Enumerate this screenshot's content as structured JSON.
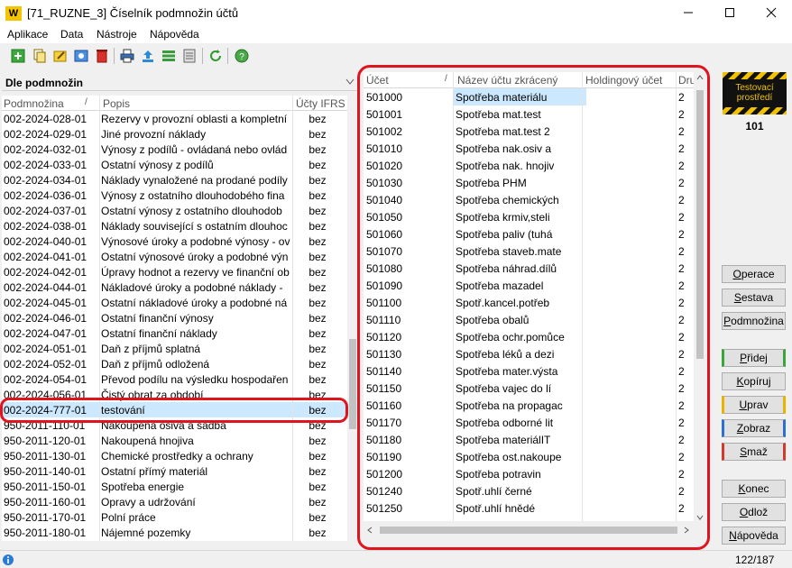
{
  "window": {
    "title": "[71_RUZNE_3] Číselník podmnožin účtů",
    "icon_label": "W",
    "controls": [
      "minimize-icon",
      "maximize-icon",
      "close-icon"
    ]
  },
  "menu": [
    "Aplikace",
    "Data",
    "Nástroje",
    "Nápověda"
  ],
  "toolbar_icons": [
    "add-icon",
    "copy-icon",
    "edit-icon",
    "view-icon",
    "delete-icon",
    "print-icon",
    "export-icon",
    "list-icon",
    "layout-icon",
    "refresh-icon",
    "help-icon"
  ],
  "left_panel": {
    "heading": "Dle podmnožin",
    "columns": [
      "Podmnožina",
      "Popis",
      "Účty IFRS"
    ],
    "rows": [
      [
        "002-2024-028-01",
        "Rezervy v provozní oblasti a kompletní",
        "bez"
      ],
      [
        "002-2024-029-01",
        "Jiné provozní náklady",
        "bez"
      ],
      [
        "002-2024-032-01",
        "Výnosy z podílů - ovládaná nebo ovlád",
        "bez"
      ],
      [
        "002-2024-033-01",
        "Ostatní výnosy  z podílů",
        "bez"
      ],
      [
        "002-2024-034-01",
        "Náklady vynaložené na prodané podíly",
        "bez"
      ],
      [
        "002-2024-036-01",
        "Výnosy z ostatního dlouhodobého fina",
        "bez"
      ],
      [
        "002-2024-037-01",
        "Ostatní výnosy z ostatního dlouhodob",
        "bez"
      ],
      [
        "002-2024-038-01",
        "Náklady související s ostatním dlouhoc",
        "bez"
      ],
      [
        "002-2024-040-01",
        "Výnosové úroky a podobné výnosy - ov",
        "bez"
      ],
      [
        "002-2024-041-01",
        "Ostatní výnosové úroky a podobné výn",
        "bez"
      ],
      [
        "002-2024-042-01",
        "Úpravy hodnot a rezervy ve finanční ob",
        "bez"
      ],
      [
        "002-2024-044-01",
        "Nákladové úroky a podobné náklady -",
        "bez"
      ],
      [
        "002-2024-045-01",
        "Ostatní nákladové úroky a podobné ná",
        "bez"
      ],
      [
        "002-2024-046-01",
        "Ostatní finanční výnosy",
        "bez"
      ],
      [
        "002-2024-047-01",
        "Ostatní finanční náklady",
        "bez"
      ],
      [
        "002-2024-051-01",
        "Daň z příjmů splatná",
        "bez"
      ],
      [
        "002-2024-052-01",
        "Daň z příjmů odložená",
        "bez"
      ],
      [
        "002-2024-054-01",
        "Převod podílu na výsledku hospodařen",
        "bez"
      ],
      [
        "002-2024-056-01",
        "Čistý obrat za období",
        "bez"
      ],
      [
        "002-2024-777-01",
        "testování",
        "bez"
      ],
      [
        "950-2011-110-01",
        "Nakoupená osiva a sadba",
        "bez"
      ],
      [
        "950-2011-120-01",
        "Nakoupená hnojiva",
        "bez"
      ],
      [
        "950-2011-130-01",
        "Chemické prostředky a ochrany",
        "bez"
      ],
      [
        "950-2011-140-01",
        "Ostatní přímý materiál",
        "bez"
      ],
      [
        "950-2011-150-01",
        "Spotřeba energie",
        "bez"
      ],
      [
        "950-2011-160-01",
        "Opravy a udržování",
        "bez"
      ],
      [
        "950-2011-170-01",
        "Polní práce",
        "bez"
      ],
      [
        "950-2011-180-01",
        "Nájemné pozemky",
        "bez"
      ]
    ],
    "selected_index": 19
  },
  "right_panel": {
    "columns": [
      "Účet",
      "Název účtu zkrácený",
      "Holdingový účet",
      "Dru"
    ],
    "rows": [
      [
        "501000",
        "Spotřeba materiálu",
        "",
        "2"
      ],
      [
        "501001",
        "Spotřeba mat.test",
        "",
        "2"
      ],
      [
        "501002",
        "Spotřeba mat.test 2",
        "",
        "2"
      ],
      [
        "501010",
        "Spotřeba nak.osiv a",
        "",
        "2"
      ],
      [
        "501020",
        "Spotřeba nak. hnojiv",
        "",
        "2"
      ],
      [
        "501030",
        "Spotřeba PHM",
        "",
        "2"
      ],
      [
        "501040",
        "Spotřeba chemických",
        "",
        "2"
      ],
      [
        "501050",
        "Spotřeba krmiv,steli",
        "",
        "2"
      ],
      [
        "501060",
        "Spotřeba paliv (tuhá",
        "",
        "2"
      ],
      [
        "501070",
        "Spotřeba staveb.mate",
        "",
        "2"
      ],
      [
        "501080",
        "Spotřeba náhrad.dílů",
        "",
        "2"
      ],
      [
        "501090",
        "Spotřeba mazadel",
        "",
        "2"
      ],
      [
        "501100",
        "Spotř.kancel.potřeb",
        "",
        "2"
      ],
      [
        "501110",
        "Spotřeba obalů",
        "",
        "2"
      ],
      [
        "501120",
        "Spotřeba ochr.pomůce",
        "",
        "2"
      ],
      [
        "501130",
        "Spotřeba léků a dezi",
        "",
        "2"
      ],
      [
        "501140",
        "Spotřeba mater.výsta",
        "",
        "2"
      ],
      [
        "501150",
        "Spotřeba vajec do lí",
        "",
        "2"
      ],
      [
        "501160",
        "Spotřeba na propagac",
        "",
        "2"
      ],
      [
        "501170",
        "Spotřeba odborné lit",
        "",
        "2"
      ],
      [
        "501180",
        "Spotřeba materiálIT",
        "",
        "2"
      ],
      [
        "501190",
        "Spotřeba ost.nakoupe",
        "",
        "2"
      ],
      [
        "501200",
        "Spotřeba potravin",
        "",
        "2"
      ],
      [
        "501240",
        "Spotř.uhlí černé",
        "",
        "2"
      ],
      [
        "501250",
        "Spotř.uhlí hnědé",
        "",
        "2"
      ]
    ]
  },
  "side_panel": {
    "badge_text": "Testovací prostředí",
    "badge_number": "101",
    "buttons": {
      "operace": "Operace",
      "sestava": "Sestava",
      "podmnozina": "Podmnožina",
      "pridej": "Přidej",
      "kopiruj": "Kopíruj",
      "uprav": "Uprav",
      "zobraz": "Zobraz",
      "smaz": "Smaž",
      "konec": "Konec",
      "odloz": "Odlož",
      "napoveda": "Nápověda"
    }
  },
  "status": {
    "counter": "122/187"
  },
  "colors": {
    "selection": "#cce8ff",
    "highlight_outline": "#e0141e",
    "hazard_yellow": "#f2c200"
  }
}
